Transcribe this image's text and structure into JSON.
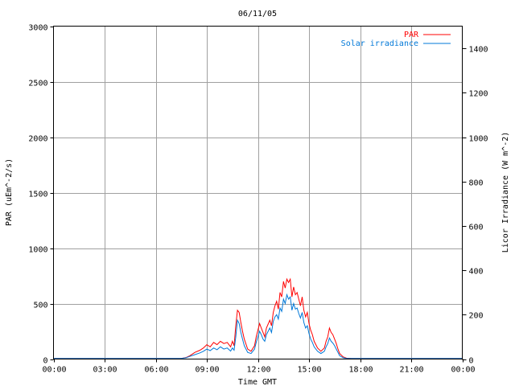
{
  "chart_data": {
    "type": "line",
    "title": "06/11/05",
    "xlabel": "Time GMT",
    "ylabel": "PAR (uEm^-2/s)",
    "y2label": "Licor Irradiance (W m^-2)",
    "xlim": [
      0,
      24
    ],
    "ylim": [
      0,
      3000
    ],
    "y2lim": [
      0,
      1500
    ],
    "x_tick_labels": [
      "00:00",
      "03:00",
      "06:00",
      "09:00",
      "12:00",
      "15:00",
      "18:00",
      "21:00",
      "00:00"
    ],
    "y_tick_labels": [
      "0",
      "500",
      "1000",
      "1500",
      "2000",
      "2500",
      "3000"
    ],
    "y2_tick_labels": [
      "0",
      "200",
      "400",
      "600",
      "800",
      "1000",
      "1200",
      "1400"
    ],
    "grid": true,
    "legend_position": "top-right",
    "series": [
      {
        "name": "PAR",
        "axis": "left",
        "color": "#ff0000",
        "points": [
          [
            0,
            5
          ],
          [
            7.5,
            5
          ],
          [
            7.8,
            15
          ],
          [
            8.0,
            30
          ],
          [
            8.3,
            60
          ],
          [
            8.6,
            80
          ],
          [
            8.8,
            100
          ],
          [
            9.0,
            130
          ],
          [
            9.2,
            110
          ],
          [
            9.4,
            150
          ],
          [
            9.6,
            130
          ],
          [
            9.8,
            160
          ],
          [
            10.0,
            140
          ],
          [
            10.2,
            150
          ],
          [
            10.4,
            110
          ],
          [
            10.5,
            160
          ],
          [
            10.6,
            120
          ],
          [
            10.7,
            300
          ],
          [
            10.8,
            440
          ],
          [
            10.9,
            420
          ],
          [
            11.0,
            330
          ],
          [
            11.1,
            250
          ],
          [
            11.2,
            180
          ],
          [
            11.4,
            90
          ],
          [
            11.6,
            70
          ],
          [
            11.8,
            120
          ],
          [
            11.9,
            200
          ],
          [
            12.0,
            260
          ],
          [
            12.1,
            320
          ],
          [
            12.2,
            280
          ],
          [
            12.3,
            240
          ],
          [
            12.4,
            200
          ],
          [
            12.5,
            280
          ],
          [
            12.7,
            350
          ],
          [
            12.8,
            300
          ],
          [
            12.9,
            420
          ],
          [
            13.0,
            480
          ],
          [
            13.1,
            520
          ],
          [
            13.2,
            450
          ],
          [
            13.3,
            600
          ],
          [
            13.4,
            560
          ],
          [
            13.5,
            700
          ],
          [
            13.6,
            640
          ],
          [
            13.7,
            720
          ],
          [
            13.8,
            690
          ],
          [
            13.9,
            720
          ],
          [
            14.0,
            560
          ],
          [
            14.1,
            650
          ],
          [
            14.2,
            580
          ],
          [
            14.3,
            600
          ],
          [
            14.4,
            540
          ],
          [
            14.5,
            480
          ],
          [
            14.6,
            560
          ],
          [
            14.7,
            440
          ],
          [
            14.8,
            380
          ],
          [
            14.9,
            420
          ],
          [
            15.0,
            320
          ],
          [
            15.1,
            260
          ],
          [
            15.2,
            220
          ],
          [
            15.3,
            160
          ],
          [
            15.5,
            100
          ],
          [
            15.7,
            70
          ],
          [
            15.9,
            100
          ],
          [
            16.0,
            160
          ],
          [
            16.1,
            200
          ],
          [
            16.2,
            280
          ],
          [
            16.3,
            240
          ],
          [
            16.4,
            220
          ],
          [
            16.5,
            180
          ],
          [
            16.6,
            140
          ],
          [
            16.7,
            90
          ],
          [
            16.8,
            50
          ],
          [
            17.0,
            20
          ],
          [
            17.2,
            8
          ],
          [
            17.5,
            5
          ],
          [
            24,
            5
          ]
        ]
      },
      {
        "name": "Solar irradiance",
        "axis": "right",
        "color": "#0078d8",
        "points": [
          [
            0,
            3
          ],
          [
            7.5,
            3
          ],
          [
            7.8,
            6
          ],
          [
            8.0,
            12
          ],
          [
            8.3,
            20
          ],
          [
            8.6,
            28
          ],
          [
            8.8,
            35
          ],
          [
            9.0,
            45
          ],
          [
            9.2,
            38
          ],
          [
            9.4,
            50
          ],
          [
            9.6,
            42
          ],
          [
            9.8,
            55
          ],
          [
            10.0,
            45
          ],
          [
            10.2,
            50
          ],
          [
            10.4,
            36
          ],
          [
            10.5,
            50
          ],
          [
            10.6,
            40
          ],
          [
            10.7,
            100
          ],
          [
            10.8,
            175
          ],
          [
            10.9,
            160
          ],
          [
            11.0,
            120
          ],
          [
            11.1,
            90
          ],
          [
            11.2,
            60
          ],
          [
            11.4,
            30
          ],
          [
            11.6,
            25
          ],
          [
            11.8,
            45
          ],
          [
            11.9,
            75
          ],
          [
            12.0,
            100
          ],
          [
            12.1,
            125
          ],
          [
            12.2,
            110
          ],
          [
            12.3,
            90
          ],
          [
            12.4,
            80
          ],
          [
            12.5,
            110
          ],
          [
            12.7,
            140
          ],
          [
            12.8,
            120
          ],
          [
            12.9,
            170
          ],
          [
            13.0,
            190
          ],
          [
            13.1,
            200
          ],
          [
            13.2,
            180
          ],
          [
            13.3,
            230
          ],
          [
            13.4,
            215
          ],
          [
            13.5,
            270
          ],
          [
            13.6,
            250
          ],
          [
            13.7,
            290
          ],
          [
            13.8,
            270
          ],
          [
            13.9,
            280
          ],
          [
            14.0,
            220
          ],
          [
            14.1,
            250
          ],
          [
            14.2,
            225
          ],
          [
            14.3,
            230
          ],
          [
            14.4,
            205
          ],
          [
            14.5,
            185
          ],
          [
            14.6,
            210
          ],
          [
            14.7,
            165
          ],
          [
            14.8,
            140
          ],
          [
            14.9,
            150
          ],
          [
            15.0,
            115
          ],
          [
            15.1,
            90
          ],
          [
            15.2,
            75
          ],
          [
            15.3,
            55
          ],
          [
            15.5,
            35
          ],
          [
            15.7,
            25
          ],
          [
            15.9,
            35
          ],
          [
            16.0,
            55
          ],
          [
            16.1,
            70
          ],
          [
            16.2,
            95
          ],
          [
            16.3,
            80
          ],
          [
            16.4,
            72
          ],
          [
            16.5,
            60
          ],
          [
            16.6,
            45
          ],
          [
            16.7,
            30
          ],
          [
            16.8,
            15
          ],
          [
            17.0,
            6
          ],
          [
            17.2,
            3
          ],
          [
            24,
            3
          ]
        ]
      }
    ]
  }
}
